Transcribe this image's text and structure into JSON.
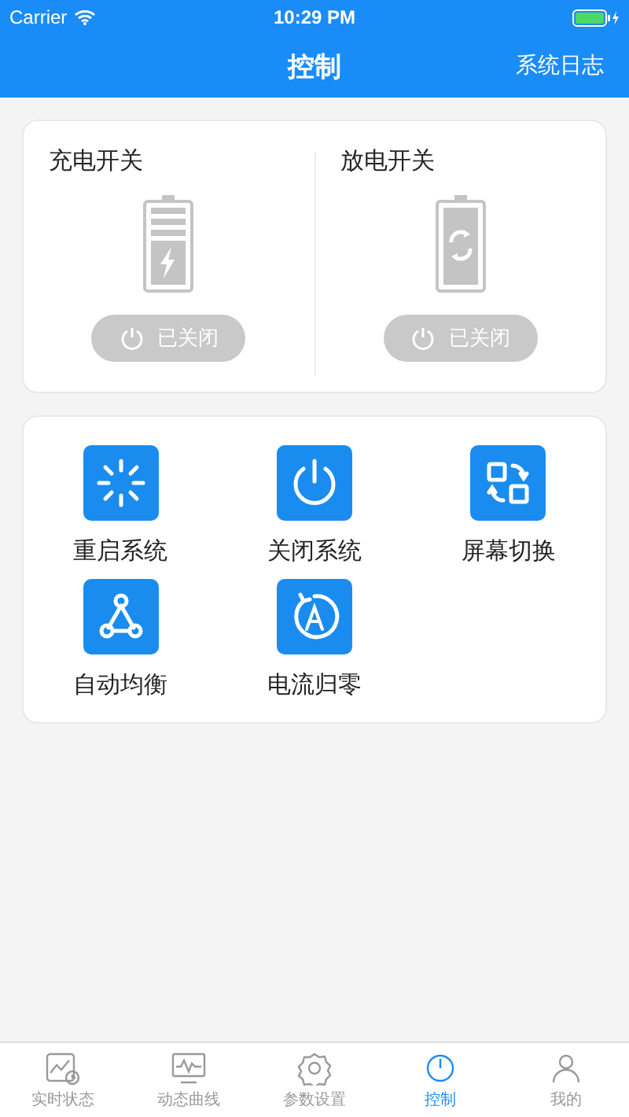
{
  "status_bar": {
    "carrier": "Carrier",
    "time": "10:29 PM"
  },
  "nav_bar": {
    "title": "控制",
    "action": "系统日志"
  },
  "switches": [
    {
      "label": "充电开关",
      "kind": "charge",
      "on": false,
      "state_text": "已关闭"
    },
    {
      "label": "放电开关",
      "kind": "discharge",
      "on": false,
      "state_text": "已关闭"
    }
  ],
  "functions": [
    {
      "label": "重启系统",
      "kind": "restart"
    },
    {
      "label": "关闭系统",
      "kind": "power"
    },
    {
      "label": "屏幕切换",
      "kind": "switch-screen"
    },
    {
      "label": "自动均衡",
      "kind": "balance"
    },
    {
      "label": "电流归零",
      "kind": "zero"
    }
  ],
  "tab_bar": [
    {
      "label": "实时状态",
      "kind": "realtime",
      "selected": false
    },
    {
      "label": "动态曲线",
      "kind": "curve",
      "selected": false
    },
    {
      "label": "参数设置",
      "kind": "settings",
      "selected": false
    },
    {
      "label": "控制",
      "kind": "control",
      "selected": true
    },
    {
      "label": "我的",
      "kind": "me",
      "selected": false
    }
  ]
}
